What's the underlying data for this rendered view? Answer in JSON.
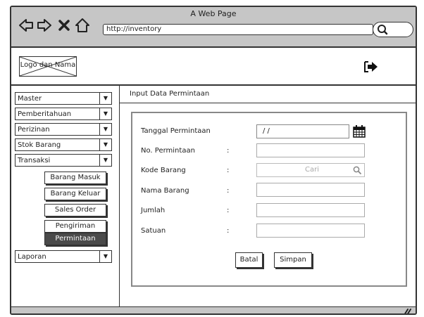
{
  "browser": {
    "title": "A Web Page",
    "url": "http://inventory"
  },
  "header": {
    "logo_text": "Logo dan Nama",
    "logout_icon": "logout-icon"
  },
  "sidebar": {
    "menus": [
      {
        "label": "Master"
      },
      {
        "label": "Pemberitahuan"
      },
      {
        "label": "Perizinan"
      },
      {
        "label": "Stok Barang"
      },
      {
        "label": "Transaksi"
      }
    ],
    "submenus": [
      {
        "label": "Barang Masuk",
        "active": false
      },
      {
        "label": "Barang Keluar",
        "active": false
      },
      {
        "label": "Sales Order",
        "active": false
      },
      {
        "label": "Pengiriman",
        "active": false
      },
      {
        "label": "Permintaan",
        "active": true
      }
    ],
    "bottom_menu": {
      "label": "Laporan"
    }
  },
  "content": {
    "title": "Input Data Permintaan",
    "form": {
      "fields": [
        {
          "label": "Tanggal Permintaan",
          "value": "/ /",
          "colon": ""
        },
        {
          "label": "No. Permintaan",
          "value": "",
          "colon": ":"
        },
        {
          "label": "Kode Barang",
          "placeholder": "Cari",
          "colon": ":"
        },
        {
          "label": "Nama Barang",
          "value": "",
          "colon": ":"
        },
        {
          "label": "Jumlah",
          "value": "",
          "colon": ":"
        },
        {
          "label": "Satuan",
          "value": "",
          "colon": ":"
        }
      ],
      "buttons": {
        "cancel": "Batal",
        "save": "Simpan"
      }
    }
  }
}
